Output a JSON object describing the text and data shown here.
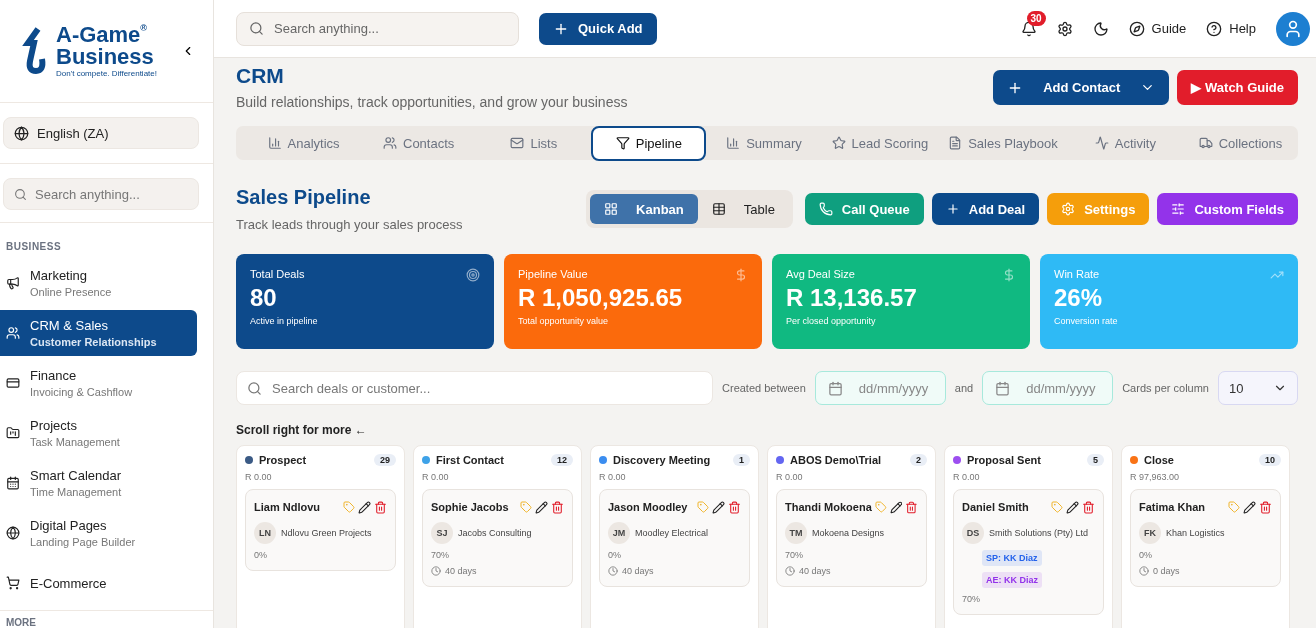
{
  "sidebar": {
    "logo": {
      "line_1": "A-Game",
      "line_2": "Business",
      "mark": "®",
      "tagline": "Don't compete. Differentiate!"
    },
    "language": "English (ZA)",
    "search": {
      "placeholder": "Search anything..."
    },
    "section": "BUSINESS",
    "items": [
      {
        "kind": "marketing",
        "title": "Marketing",
        "subtitle": "Online Presence",
        "selected": false
      },
      {
        "kind": "crm",
        "title": "CRM & Sales",
        "subtitle": "Customer Relationships",
        "selected": true
      },
      {
        "kind": "finance",
        "title": "Finance",
        "subtitle": "Invoicing & Cashflow",
        "selected": false
      },
      {
        "kind": "projects",
        "title": "Projects",
        "subtitle": "Task Management",
        "selected": false
      },
      {
        "kind": "calendar",
        "title": "Smart Calendar",
        "subtitle": "Time Management",
        "selected": false
      },
      {
        "kind": "pages",
        "title": "Digital Pages",
        "subtitle": "Landing Page Builder",
        "selected": false
      },
      {
        "kind": "commerce",
        "title": "E-Commerce",
        "selected": false
      }
    ],
    "more": "MORE"
  },
  "topbar": {
    "search": {
      "placeholder": "Search anything..."
    },
    "quick_add": "Quick Add",
    "notifications": "30",
    "guide": "Guide",
    "help": "Help"
  },
  "header": {
    "title": "CRM",
    "subtitle": "Build relationships, track opportunities, and grow your business",
    "add_contact": "Add Contact",
    "watch_guide": "▶ Watch Guide"
  },
  "tabs": [
    {
      "kind": "analytics",
      "label": "Analytics",
      "selected": false
    },
    {
      "kind": "contacts",
      "label": "Contacts",
      "selected": false
    },
    {
      "kind": "lists",
      "label": "Lists",
      "selected": false
    },
    {
      "kind": "pipeline",
      "label": "Pipeline",
      "selected": true
    },
    {
      "kind": "summary",
      "label": "Summary",
      "selected": false
    },
    {
      "kind": "scoring",
      "label": "Lead Scoring",
      "selected": false
    },
    {
      "kind": "playbook",
      "label": "Sales Playbook",
      "selected": false
    },
    {
      "kind": "activity",
      "label": "Activity",
      "selected": false
    },
    {
      "kind": "collections",
      "label": "Collections",
      "selected": false
    }
  ],
  "pipeline": {
    "title": "Sales Pipeline",
    "subtitle": "Track leads through your sales process",
    "views": [
      {
        "kind": "kanban",
        "label": "Kanban",
        "selected": true
      },
      {
        "kind": "table",
        "label": "Table",
        "selected": false
      }
    ],
    "actions": [
      {
        "kind": "phone",
        "label": "Call Queue",
        "color": "#0f9f7f"
      },
      {
        "kind": "plus",
        "label": "Add Deal",
        "color": "#0b4a8b"
      },
      {
        "kind": "gear",
        "label": "Settings",
        "color": "#f59e0b"
      },
      {
        "kind": "sliders",
        "label": "Custom Fields",
        "color": "#9333ea"
      }
    ],
    "stats": [
      {
        "kind": "target",
        "label": "Total Deals",
        "value": "80",
        "caption": "Active in pipeline",
        "color": "#0d4a8b"
      },
      {
        "kind": "dollar",
        "label": "Pipeline Value",
        "value": "R 1,050,925.65",
        "caption": "Total opportunity value",
        "color": "#fb6a0c"
      },
      {
        "kind": "dollar",
        "label": "Avg Deal Size",
        "value": "R 13,136.57",
        "caption": "Per closed opportunity",
        "color": "#10b981"
      },
      {
        "kind": "trend",
        "label": "Win Rate",
        "value": "26%",
        "caption": "Conversion rate",
        "color": "#2fbaf5"
      }
    ],
    "filters": {
      "search": {
        "placeholder": "Search deals or customer..."
      },
      "created_between": "Created between",
      "from": {
        "placeholder": "dd/mm/yyyy"
      },
      "and": "and",
      "to": {
        "placeholder": "dd/mm/yyyy"
      },
      "cards_per_column": "Cards per column",
      "cards_value": "10"
    },
    "scroll_hint": "Scroll right for more ←",
    "columns": [
      {
        "name": "Prospect",
        "color": "#3b5a85",
        "count": "29",
        "total": "R 0.00",
        "cards": [
          {
            "name": "Liam Ndlovu",
            "initials": "LN",
            "company": "Ndlovu Green Projects",
            "probability": "0%"
          }
        ]
      },
      {
        "name": "First Contact",
        "color": "#3ea2e8",
        "count": "12",
        "total": "R 0.00",
        "cards": [
          {
            "name": "Sophie Jacobs",
            "initials": "SJ",
            "company": "Jacobs Consulting",
            "probability": "70%",
            "days": "40 days"
          }
        ]
      },
      {
        "name": "Discovery Meeting",
        "color": "#3b8df0",
        "count": "1",
        "total": "R 0.00",
        "cards": [
          {
            "name": "Jason Moodley",
            "initials": "JM",
            "company": "Moodley Electrical",
            "probability": "0%",
            "days": "40 days"
          }
        ]
      },
      {
        "name": "ABOS Demo\\Trial",
        "color": "#6366f1",
        "count": "2",
        "total": "R 0.00",
        "cards": [
          {
            "name": "Thandi Mokoena",
            "initials": "TM",
            "company": "Mokoena Designs",
            "probability": "70%",
            "days": "40 days"
          }
        ]
      },
      {
        "name": "Proposal Sent",
        "color": "#9d4ff0",
        "count": "5",
        "total": "R 0.00",
        "cards": [
          {
            "name": "Daniel Smith",
            "initials": "DS",
            "company": "Smith Solutions (Pty) Ltd",
            "tags": [
              {
                "label": "SP: KK Diaz",
                "color": "#2563eb"
              },
              {
                "label": "AE: KK Diaz",
                "color": "#9333ea"
              }
            ],
            "probability": "70%"
          }
        ]
      },
      {
        "name": "Close",
        "color": "#f97316",
        "count": "10",
        "total": "R 97,963.00",
        "cards": [
          {
            "name": "Fatima Khan",
            "initials": "FK",
            "company": "Khan Logistics",
            "probability": "0%",
            "days": "0 days"
          }
        ]
      }
    ]
  }
}
